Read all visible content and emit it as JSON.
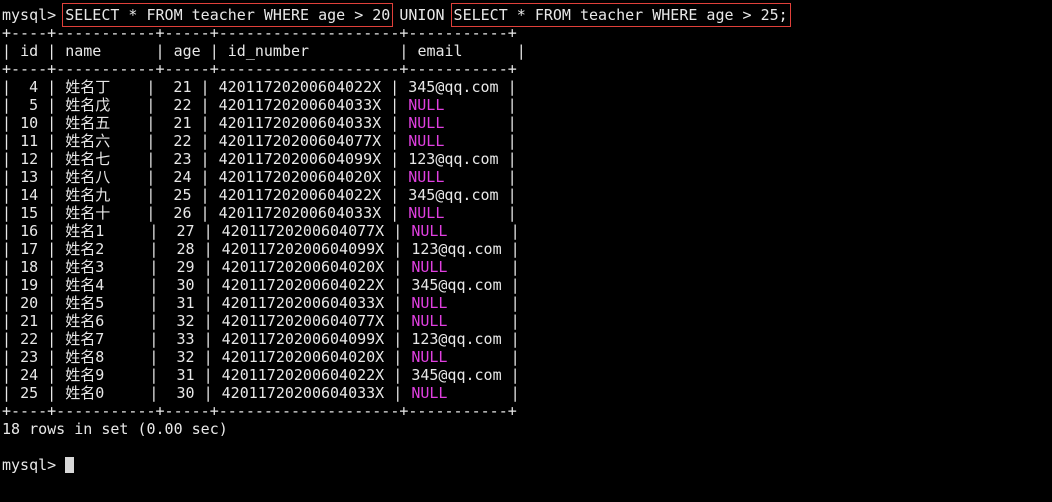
{
  "prompt": "mysql> ",
  "query": {
    "part1": "SELECT * FROM teacher WHERE age > 20",
    "union": " UNION ",
    "part2": "SELECT * FROM teacher WHERE age > 25;"
  },
  "table": {
    "border": "+----+-----------+-----+--------------------+-----------+",
    "header": {
      "id": "id",
      "name": "name",
      "age": "age",
      "id_number": "id_number",
      "email": "email"
    },
    "rows": [
      {
        "id": "4",
        "name": "姓名丁",
        "age": "21",
        "id_number": "42011720200604022X",
        "email": "345@qq.com",
        "is_null": false
      },
      {
        "id": "5",
        "name": "姓名戊",
        "age": "22",
        "id_number": "42011720200604033X",
        "email": "NULL",
        "is_null": true
      },
      {
        "id": "10",
        "name": "姓名五",
        "age": "21",
        "id_number": "42011720200604033X",
        "email": "NULL",
        "is_null": true
      },
      {
        "id": "11",
        "name": "姓名六",
        "age": "22",
        "id_number": "42011720200604077X",
        "email": "NULL",
        "is_null": true
      },
      {
        "id": "12",
        "name": "姓名七",
        "age": "23",
        "id_number": "42011720200604099X",
        "email": "123@qq.com",
        "is_null": false
      },
      {
        "id": "13",
        "name": "姓名八",
        "age": "24",
        "id_number": "42011720200604020X",
        "email": "NULL",
        "is_null": true
      },
      {
        "id": "14",
        "name": "姓名九",
        "age": "25",
        "id_number": "42011720200604022X",
        "email": "345@qq.com",
        "is_null": false
      },
      {
        "id": "15",
        "name": "姓名十",
        "age": "26",
        "id_number": "42011720200604033X",
        "email": "NULL",
        "is_null": true
      },
      {
        "id": "16",
        "name": "姓名1",
        "age": "27",
        "id_number": "42011720200604077X",
        "email": "NULL",
        "is_null": true
      },
      {
        "id": "17",
        "name": "姓名2",
        "age": "28",
        "id_number": "42011720200604099X",
        "email": "123@qq.com",
        "is_null": false
      },
      {
        "id": "18",
        "name": "姓名3",
        "age": "29",
        "id_number": "42011720200604020X",
        "email": "NULL",
        "is_null": true
      },
      {
        "id": "19",
        "name": "姓名4",
        "age": "30",
        "id_number": "42011720200604022X",
        "email": "345@qq.com",
        "is_null": false
      },
      {
        "id": "20",
        "name": "姓名5",
        "age": "31",
        "id_number": "42011720200604033X",
        "email": "NULL",
        "is_null": true
      },
      {
        "id": "21",
        "name": "姓名6",
        "age": "32",
        "id_number": "42011720200604077X",
        "email": "NULL",
        "is_null": true
      },
      {
        "id": "22",
        "name": "姓名7",
        "age": "33",
        "id_number": "42011720200604099X",
        "email": "123@qq.com",
        "is_null": false
      },
      {
        "id": "23",
        "name": "姓名8",
        "age": "32",
        "id_number": "42011720200604020X",
        "email": "NULL",
        "is_null": true
      },
      {
        "id": "24",
        "name": "姓名9",
        "age": "31",
        "id_number": "42011720200604022X",
        "email": "345@qq.com",
        "is_null": false
      },
      {
        "id": "25",
        "name": "姓名0",
        "age": "30",
        "id_number": "42011720200604033X",
        "email": "NULL",
        "is_null": true
      }
    ]
  },
  "result_summary": "18 rows in set (0.00 sec)",
  "colors": {
    "background": "#000000",
    "text": "#e8e8e8",
    "null_text": "#e040e0",
    "highlight_box": "#e0403a",
    "cursor": "#d8d8d8"
  }
}
